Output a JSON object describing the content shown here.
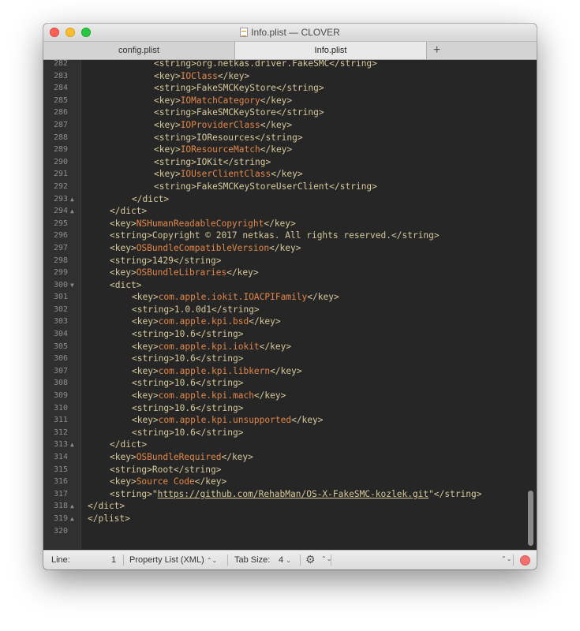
{
  "window": {
    "title": "Info.plist — CLOVER",
    "traffic_lights": [
      "close",
      "minimize",
      "zoom"
    ]
  },
  "tabs": [
    {
      "label": "config.plist",
      "active": false
    },
    {
      "label": "Info.plist",
      "active": true
    }
  ],
  "tab_add": "+",
  "editor": {
    "lines": [
      {
        "n": "282",
        "fold": "",
        "indent": 3,
        "p": [
          {
            "t": "<string>",
            "c": "str"
          },
          {
            "t": "org.netkas.driver.FakeSMC",
            "c": "str"
          },
          {
            "t": "</string>",
            "c": "str"
          }
        ]
      },
      {
        "n": "283",
        "fold": "",
        "indent": 3,
        "p": [
          {
            "t": "<key>",
            "c": "str"
          },
          {
            "t": "IOClass",
            "c": "key"
          },
          {
            "t": "</key>",
            "c": "str"
          }
        ]
      },
      {
        "n": "284",
        "fold": "",
        "indent": 3,
        "p": [
          {
            "t": "<string>",
            "c": "str"
          },
          {
            "t": "FakeSMCKeyStore",
            "c": "str"
          },
          {
            "t": "</string>",
            "c": "str"
          }
        ]
      },
      {
        "n": "285",
        "fold": "",
        "indent": 3,
        "p": [
          {
            "t": "<key>",
            "c": "str"
          },
          {
            "t": "IOMatchCategory",
            "c": "key"
          },
          {
            "t": "</key>",
            "c": "str"
          }
        ]
      },
      {
        "n": "286",
        "fold": "",
        "indent": 3,
        "p": [
          {
            "t": "<string>",
            "c": "str"
          },
          {
            "t": "FakeSMCKeyStore",
            "c": "str"
          },
          {
            "t": "</string>",
            "c": "str"
          }
        ]
      },
      {
        "n": "287",
        "fold": "",
        "indent": 3,
        "p": [
          {
            "t": "<key>",
            "c": "str"
          },
          {
            "t": "IOProviderClass",
            "c": "key"
          },
          {
            "t": "</key>",
            "c": "str"
          }
        ]
      },
      {
        "n": "288",
        "fold": "",
        "indent": 3,
        "p": [
          {
            "t": "<string>",
            "c": "str"
          },
          {
            "t": "IOResources",
            "c": "str"
          },
          {
            "t": "</string>",
            "c": "str"
          }
        ]
      },
      {
        "n": "289",
        "fold": "",
        "indent": 3,
        "p": [
          {
            "t": "<key>",
            "c": "str"
          },
          {
            "t": "IOResourceMatch",
            "c": "key"
          },
          {
            "t": "</key>",
            "c": "str"
          }
        ]
      },
      {
        "n": "290",
        "fold": "",
        "indent": 3,
        "p": [
          {
            "t": "<string>",
            "c": "str"
          },
          {
            "t": "IOKit",
            "c": "str"
          },
          {
            "t": "</string>",
            "c": "str"
          }
        ]
      },
      {
        "n": "291",
        "fold": "",
        "indent": 3,
        "p": [
          {
            "t": "<key>",
            "c": "str"
          },
          {
            "t": "IOUserClientClass",
            "c": "key"
          },
          {
            "t": "</key>",
            "c": "str"
          }
        ]
      },
      {
        "n": "292",
        "fold": "",
        "indent": 3,
        "p": [
          {
            "t": "<string>",
            "c": "str"
          },
          {
            "t": "FakeSMCKeyStoreUserClient",
            "c": "str"
          },
          {
            "t": "</string>",
            "c": "str"
          }
        ]
      },
      {
        "n": "293",
        "fold": "▲",
        "indent": 2,
        "p": [
          {
            "t": "</dict>",
            "c": "str"
          }
        ]
      },
      {
        "n": "294",
        "fold": "▲",
        "indent": 1,
        "p": [
          {
            "t": "</dict>",
            "c": "str"
          }
        ]
      },
      {
        "n": "295",
        "fold": "",
        "indent": 1,
        "p": [
          {
            "t": "<key>",
            "c": "str"
          },
          {
            "t": "NSHumanReadableCopyright",
            "c": "key"
          },
          {
            "t": "</key>",
            "c": "str"
          }
        ]
      },
      {
        "n": "296",
        "fold": "",
        "indent": 1,
        "p": [
          {
            "t": "<string>",
            "c": "str"
          },
          {
            "t": "Copyright © 2017 netkas. All rights reserved.",
            "c": "str"
          },
          {
            "t": "</string>",
            "c": "str"
          }
        ]
      },
      {
        "n": "297",
        "fold": "",
        "indent": 1,
        "p": [
          {
            "t": "<key>",
            "c": "str"
          },
          {
            "t": "OSBundleCompatibleVersion",
            "c": "key"
          },
          {
            "t": "</key>",
            "c": "str"
          }
        ]
      },
      {
        "n": "298",
        "fold": "",
        "indent": 1,
        "p": [
          {
            "t": "<string>",
            "c": "str"
          },
          {
            "t": "1429",
            "c": "str"
          },
          {
            "t": "</string>",
            "c": "str"
          }
        ]
      },
      {
        "n": "299",
        "fold": "",
        "indent": 1,
        "p": [
          {
            "t": "<key>",
            "c": "str"
          },
          {
            "t": "OSBundleLibraries",
            "c": "key"
          },
          {
            "t": "</key>",
            "c": "str"
          }
        ]
      },
      {
        "n": "300",
        "fold": "▼",
        "indent": 1,
        "p": [
          {
            "t": "<dict>",
            "c": "str"
          }
        ]
      },
      {
        "n": "301",
        "fold": "",
        "indent": 2,
        "p": [
          {
            "t": "<key>",
            "c": "str"
          },
          {
            "t": "com.apple.iokit.IOACPIFamily",
            "c": "key"
          },
          {
            "t": "</key>",
            "c": "str"
          }
        ]
      },
      {
        "n": "302",
        "fold": "",
        "indent": 2,
        "p": [
          {
            "t": "<string>",
            "c": "str"
          },
          {
            "t": "1.0.0d1",
            "c": "str"
          },
          {
            "t": "</string>",
            "c": "str"
          }
        ]
      },
      {
        "n": "303",
        "fold": "",
        "indent": 2,
        "p": [
          {
            "t": "<key>",
            "c": "str"
          },
          {
            "t": "com.apple.kpi.bsd",
            "c": "key"
          },
          {
            "t": "</key>",
            "c": "str"
          }
        ]
      },
      {
        "n": "304",
        "fold": "",
        "indent": 2,
        "p": [
          {
            "t": "<string>",
            "c": "str"
          },
          {
            "t": "10.6",
            "c": "str"
          },
          {
            "t": "</string>",
            "c": "str"
          }
        ]
      },
      {
        "n": "305",
        "fold": "",
        "indent": 2,
        "p": [
          {
            "t": "<key>",
            "c": "str"
          },
          {
            "t": "com.apple.kpi.iokit",
            "c": "key"
          },
          {
            "t": "</key>",
            "c": "str"
          }
        ]
      },
      {
        "n": "306",
        "fold": "",
        "indent": 2,
        "p": [
          {
            "t": "<string>",
            "c": "str"
          },
          {
            "t": "10.6",
            "c": "str"
          },
          {
            "t": "</string>",
            "c": "str"
          }
        ]
      },
      {
        "n": "307",
        "fold": "",
        "indent": 2,
        "p": [
          {
            "t": "<key>",
            "c": "str"
          },
          {
            "t": "com.apple.kpi.libkern",
            "c": "key"
          },
          {
            "t": "</key>",
            "c": "str"
          }
        ]
      },
      {
        "n": "308",
        "fold": "",
        "indent": 2,
        "p": [
          {
            "t": "<string>",
            "c": "str"
          },
          {
            "t": "10.6",
            "c": "str"
          },
          {
            "t": "</string>",
            "c": "str"
          }
        ]
      },
      {
        "n": "309",
        "fold": "",
        "indent": 2,
        "p": [
          {
            "t": "<key>",
            "c": "str"
          },
          {
            "t": "com.apple.kpi.mach",
            "c": "key"
          },
          {
            "t": "</key>",
            "c": "str"
          }
        ]
      },
      {
        "n": "310",
        "fold": "",
        "indent": 2,
        "p": [
          {
            "t": "<string>",
            "c": "str"
          },
          {
            "t": "10.6",
            "c": "str"
          },
          {
            "t": "</string>",
            "c": "str"
          }
        ]
      },
      {
        "n": "311",
        "fold": "",
        "indent": 2,
        "p": [
          {
            "t": "<key>",
            "c": "str"
          },
          {
            "t": "com.apple.kpi.unsupported",
            "c": "key"
          },
          {
            "t": "</key>",
            "c": "str"
          }
        ]
      },
      {
        "n": "312",
        "fold": "",
        "indent": 2,
        "p": [
          {
            "t": "<string>",
            "c": "str"
          },
          {
            "t": "10.6",
            "c": "str"
          },
          {
            "t": "</string>",
            "c": "str"
          }
        ]
      },
      {
        "n": "313",
        "fold": "▲",
        "indent": 1,
        "p": [
          {
            "t": "</dict>",
            "c": "str"
          }
        ]
      },
      {
        "n": "314",
        "fold": "",
        "indent": 1,
        "p": [
          {
            "t": "<key>",
            "c": "str"
          },
          {
            "t": "OSBundleRequired",
            "c": "key"
          },
          {
            "t": "</key>",
            "c": "str"
          }
        ]
      },
      {
        "n": "315",
        "fold": "",
        "indent": 1,
        "p": [
          {
            "t": "<string>",
            "c": "str"
          },
          {
            "t": "Root",
            "c": "str"
          },
          {
            "t": "</string>",
            "c": "str"
          }
        ]
      },
      {
        "n": "316",
        "fold": "",
        "indent": 1,
        "p": [
          {
            "t": "<key>",
            "c": "str"
          },
          {
            "t": "Source Code",
            "c": "key"
          },
          {
            "t": "</key>",
            "c": "str"
          }
        ]
      },
      {
        "n": "317",
        "fold": "",
        "indent": 1,
        "p": [
          {
            "t": "<string>\"",
            "c": "str"
          },
          {
            "t": "https://github.com/RehabMan/OS-X-FakeSMC-kozlek.git",
            "c": "link"
          },
          {
            "t": "\"</string>",
            "c": "str"
          }
        ]
      },
      {
        "n": "318",
        "fold": "▲",
        "indent": 0,
        "p": [
          {
            "t": "</dict>",
            "c": "str"
          }
        ]
      },
      {
        "n": "319",
        "fold": "▲",
        "indent": 0,
        "p": [
          {
            "t": "</plist>",
            "c": "str"
          }
        ]
      },
      {
        "n": "320",
        "fold": "",
        "indent": 0,
        "p": []
      }
    ]
  },
  "statusbar": {
    "line_label": "Line:",
    "line_value": "1",
    "syntax": "Property List (XML)",
    "tab_size_label": "Tab Size:",
    "tab_size_value": "4"
  },
  "colors": {
    "background": "#262626",
    "gutter": "#303030",
    "key_text": "#e2874a",
    "string_text": "#d6c99b",
    "line_number": "#8e8e8e"
  }
}
